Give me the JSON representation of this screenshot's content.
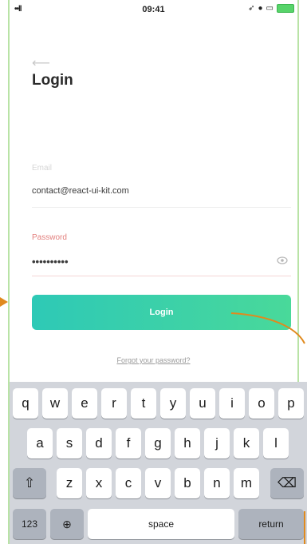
{
  "status_bar": {
    "signal": "••ll",
    "time": "09:41",
    "icons": [
      "location-icon",
      "alarm-icon",
      "screen-mirror-icon",
      "battery-icon"
    ]
  },
  "header": {
    "back_icon": "back-arrow-icon",
    "title": "Login"
  },
  "form": {
    "email": {
      "label": "Email",
      "value": "contact@react-ui-kit.com"
    },
    "password": {
      "label": "Password",
      "value": "••••••••••",
      "toggle_icon": "eye-icon"
    },
    "login_button": "Login",
    "forgot_link": "Forgot your password?"
  },
  "keyboard": {
    "row1": [
      "q",
      "w",
      "e",
      "r",
      "t",
      "y",
      "u",
      "i",
      "o",
      "p"
    ],
    "row2": [
      "a",
      "s",
      "d",
      "f",
      "g",
      "h",
      "j",
      "k",
      "l"
    ],
    "row3": [
      "z",
      "x",
      "c",
      "v",
      "b",
      "n",
      "m"
    ],
    "shift_icon": "shift-icon",
    "delete_icon": "delete-icon",
    "numbers": "123",
    "globe_icon": "globe-icon",
    "space": "space",
    "return": "return"
  },
  "colors": {
    "accent_start": "#2ec9b6",
    "accent_end": "#49d99a",
    "error_label": "#e3817f",
    "annotation": "#e08a1e"
  }
}
